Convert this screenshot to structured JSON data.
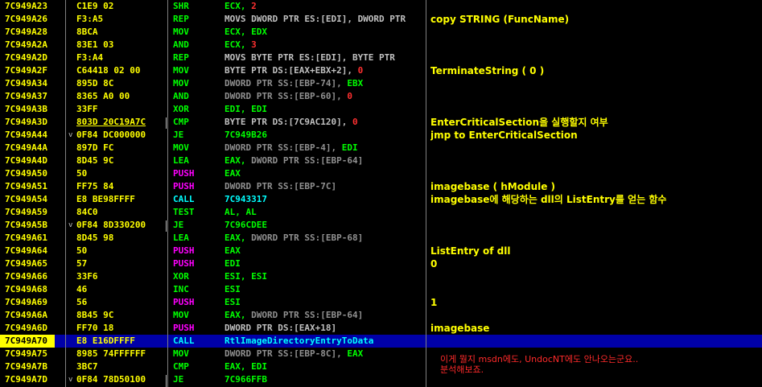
{
  "colors": {
    "background": "#000000",
    "address": "#ffff00",
    "hex": "#ffff00",
    "selected_row": "#0000a8",
    "comment": "#ffff00",
    "note": "#ff2a2a",
    "mnemonic_default": "#00ff00",
    "mnemonic_push": "#ff00ff",
    "mnemonic_call": "#00ffff",
    "operand_default": "#00ff00",
    "operand_memory": "#808080",
    "operand_imm": "#ff0000"
  },
  "rows": [
    {
      "addr": "7C949A23",
      "hex": "C1E9 02",
      "mn": "SHR",
      "mnc": "#00ff00",
      "op": [
        [
          "ECX, ",
          "#00ff00"
        ],
        [
          "2",
          "#ff3030"
        ]
      ],
      "cm": ""
    },
    {
      "addr": "7C949A26",
      "hex": "F3:A5",
      "mn": "REP",
      "mnc": "#00ff00",
      "op": [
        [
          "MOVS DWORD PTR ES:[EDI], DWORD PTR",
          "#c0c0c0"
        ]
      ],
      "cm": "copy STRING (FuncName)"
    },
    {
      "addr": "7C949A28",
      "hex": "8BCA",
      "mn": "MOV",
      "mnc": "#00ff00",
      "op": [
        [
          "ECX, EDX",
          "#00ff00"
        ]
      ],
      "cm": ""
    },
    {
      "addr": "7C949A2A",
      "hex": "83E1 03",
      "mn": "AND",
      "mnc": "#00ff00",
      "op": [
        [
          "ECX, ",
          "#00ff00"
        ],
        [
          "3",
          "#ff3030"
        ]
      ],
      "cm": ""
    },
    {
      "addr": "7C949A2D",
      "hex": "F3:A4",
      "mn": "REP",
      "mnc": "#00ff00",
      "op": [
        [
          "MOVS BYTE PTR ES:[EDI], BYTE PTR",
          "#c0c0c0"
        ]
      ],
      "cm": ""
    },
    {
      "addr": "7C949A2F",
      "hex": "C64418 02 00",
      "mn": "MOV",
      "mnc": "#00ff00",
      "op": [
        [
          "BYTE PTR DS:[EAX+EBX+2], ",
          "#c0c0c0"
        ],
        [
          "0",
          "#ff3030"
        ]
      ],
      "cm": "TerminateString ( 0 )"
    },
    {
      "addr": "7C949A34",
      "hex": "895D 8C",
      "mn": "MOV",
      "mnc": "#00ff00",
      "op": [
        [
          "DWORD PTR SS:[EBP-74], ",
          "#909090"
        ],
        [
          "EBX",
          "#00ff00"
        ]
      ],
      "cm": ""
    },
    {
      "addr": "7C949A37",
      "hex": "8365 A0 00",
      "mn": "AND",
      "mnc": "#00ff00",
      "op": [
        [
          "DWORD PTR SS:[EBP-60], ",
          "#909090"
        ],
        [
          "0",
          "#ff3030"
        ]
      ],
      "cm": ""
    },
    {
      "addr": "7C949A3B",
      "hex": "33FF",
      "mn": "XOR",
      "mnc": "#00ff00",
      "op": [
        [
          "EDI, EDI",
          "#00ff00"
        ]
      ],
      "cm": ""
    },
    {
      "addr": "7C949A3D",
      "hex": "803D 20C19A7C",
      "mn": "CMP",
      "mnc": "#00ff00",
      "op": [
        [
          "BYTE PTR DS:[7C9AC120], ",
          "#c0c0c0"
        ],
        [
          "0",
          "#ff3030"
        ]
      ],
      "cm": "EnterCriticalSection을 실행할지 여부",
      "hexul": true
    },
    {
      "addr": "7C949A44",
      "hex": "0F84 DC000000",
      "mn": "JE",
      "mnc": "#00ff00",
      "op": [
        [
          "7C949B26",
          "#00ff00"
        ]
      ],
      "cm": "jmp to EnterCriticalSection",
      "arrow": "down"
    },
    {
      "addr": "7C949A4A",
      "hex": "897D FC",
      "mn": "MOV",
      "mnc": "#00ff00",
      "op": [
        [
          "DWORD PTR SS:[EBP-4], ",
          "#909090"
        ],
        [
          "EDI",
          "#00ff00"
        ]
      ],
      "cm": ""
    },
    {
      "addr": "7C949A4D",
      "hex": "8D45 9C",
      "mn": "LEA",
      "mnc": "#00ff00",
      "op": [
        [
          "EAX, ",
          "#00ff00"
        ],
        [
          "DWORD PTR SS:[EBP-64]",
          "#909090"
        ]
      ],
      "cm": ""
    },
    {
      "addr": "7C949A50",
      "hex": "50",
      "mn": "PUSH",
      "mnc": "#ff00ff",
      "op": [
        [
          "EAX",
          "#00ff00"
        ]
      ],
      "cm": ""
    },
    {
      "addr": "7C949A51",
      "hex": "FF75 84",
      "mn": "PUSH",
      "mnc": "#ff00ff",
      "op": [
        [
          "DWORD PTR SS:[EBP-7C]",
          "#909090"
        ]
      ],
      "cm": "imagebase ( hModule )"
    },
    {
      "addr": "7C949A54",
      "hex": "E8 BE98FFFF",
      "mn": "CALL",
      "mnc": "#00ffff",
      "op": [
        [
          "7C943317",
          "#00ffff"
        ]
      ],
      "cm": "imagebase에 해당하는 dll의 ListEntry를 얻는 함수"
    },
    {
      "addr": "7C949A59",
      "hex": "84C0",
      "mn": "TEST",
      "mnc": "#00ff00",
      "op": [
        [
          "AL, AL",
          "#00ff00"
        ]
      ],
      "cm": ""
    },
    {
      "addr": "7C949A5B",
      "hex": "0F84 8D330200",
      "mn": "JE",
      "mnc": "#00ff00",
      "op": [
        [
          "7C96CDEE",
          "#00ff00"
        ]
      ],
      "cm": "",
      "arrow": "down"
    },
    {
      "addr": "7C949A61",
      "hex": "8D45 98",
      "mn": "LEA",
      "mnc": "#00ff00",
      "op": [
        [
          "EAX, ",
          "#00ff00"
        ],
        [
          "DWORD PTR SS:[EBP-68]",
          "#909090"
        ]
      ],
      "cm": ""
    },
    {
      "addr": "7C949A64",
      "hex": "50",
      "mn": "PUSH",
      "mnc": "#ff00ff",
      "op": [
        [
          "EAX",
          "#00ff00"
        ]
      ],
      "cm": "ListEntry of dll"
    },
    {
      "addr": "7C949A65",
      "hex": "57",
      "mn": "PUSH",
      "mnc": "#ff00ff",
      "op": [
        [
          "EDI",
          "#00ff00"
        ]
      ],
      "cm": "0"
    },
    {
      "addr": "7C949A66",
      "hex": "33F6",
      "mn": "XOR",
      "mnc": "#00ff00",
      "op": [
        [
          "ESI, ESI",
          "#00ff00"
        ]
      ],
      "cm": ""
    },
    {
      "addr": "7C949A68",
      "hex": "46",
      "mn": "INC",
      "mnc": "#00ff00",
      "op": [
        [
          "ESI",
          "#00ff00"
        ]
      ],
      "cm": ""
    },
    {
      "addr": "7C949A69",
      "hex": "56",
      "mn": "PUSH",
      "mnc": "#ff00ff",
      "op": [
        [
          "ESI",
          "#00ff00"
        ]
      ],
      "cm": "1"
    },
    {
      "addr": "7C949A6A",
      "hex": "8B45 9C",
      "mn": "MOV",
      "mnc": "#00ff00",
      "op": [
        [
          "EAX, ",
          "#00ff00"
        ],
        [
          "DWORD PTR SS:[EBP-64]",
          "#909090"
        ]
      ],
      "cm": ""
    },
    {
      "addr": "7C949A6D",
      "hex": "FF70 18",
      "mn": "PUSH",
      "mnc": "#ff00ff",
      "op": [
        [
          "DWORD PTR DS:[EAX+18]",
          "#c0c0c0"
        ]
      ],
      "cm": "imagebase"
    },
    {
      "addr": "7C949A70",
      "hex": "E8 E16DFFFF",
      "mn": "CALL",
      "mnc": "#00ffff",
      "op": [
        [
          "RtlImageDirectoryEntryToData",
          "#00ffff"
        ]
      ],
      "cm": "",
      "selected": true
    },
    {
      "addr": "7C949A75",
      "hex": "8985 74FFFFFF",
      "mn": "MOV",
      "mnc": "#00ff00",
      "op": [
        [
          "DWORD PTR SS:[EBP-8C], ",
          "#909090"
        ],
        [
          "EAX",
          "#00ff00"
        ]
      ],
      "cm": ""
    },
    {
      "addr": "7C949A7B",
      "hex": "3BC7",
      "mn": "CMP",
      "mnc": "#00ff00",
      "op": [
        [
          "EAX, EDI",
          "#00ff00"
        ]
      ],
      "cm": ""
    },
    {
      "addr": "7C949A7D",
      "hex": "0F84 78D50100",
      "mn": "JE",
      "mnc": "#00ff00",
      "op": [
        [
          "7C966FFB",
          "#00ff00"
        ]
      ],
      "cm": "",
      "arrow": "down"
    }
  ],
  "note": {
    "line1": "이게 뭘지 msdn에도, UndocNT에도 안나오는군요..",
    "line2": "분석해보죠."
  }
}
